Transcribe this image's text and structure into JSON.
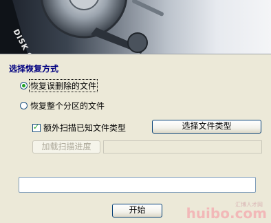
{
  "banner": {
    "logo_text": "DISK GENIUS"
  },
  "recovery": {
    "section_title": "选择恢复方式",
    "option_deleted": "恢复误删除的文件",
    "option_whole_partition": "恢复整个分区的文件",
    "extra_scan_label": "额外扫描已知文件类型",
    "select_types_button": "选择文件类型",
    "load_progress_button": "加载扫描进度",
    "start_button": "开始"
  },
  "watermark": {
    "main": "huibo.com",
    "small": "汇博人才网"
  }
}
